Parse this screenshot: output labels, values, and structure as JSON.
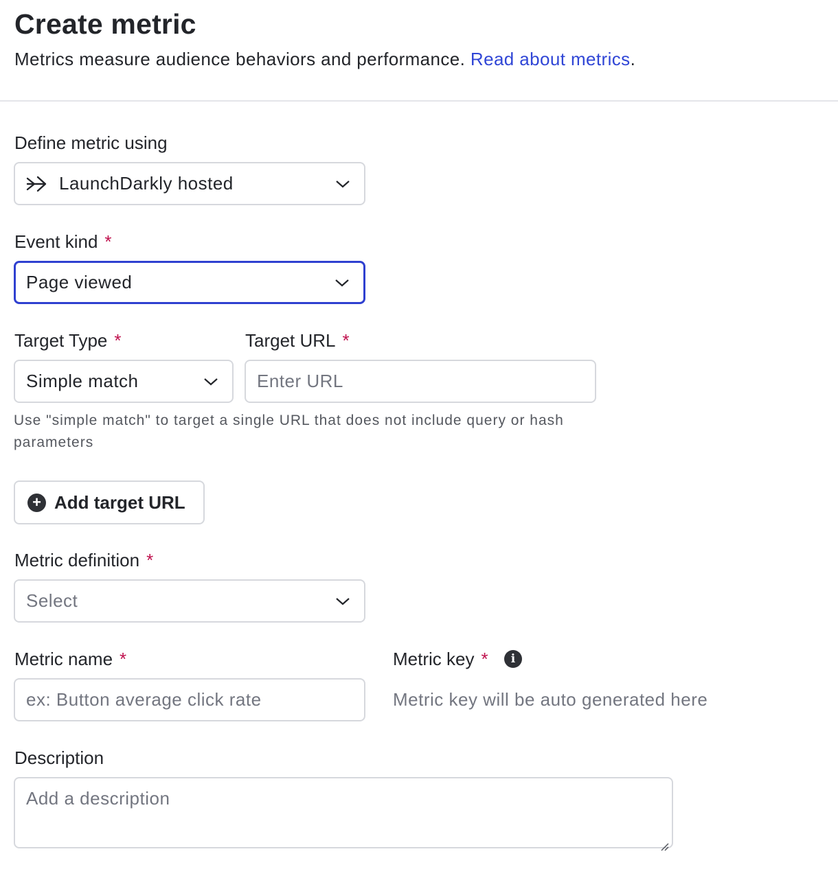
{
  "header": {
    "title": "Create metric",
    "subtitle": "Metrics measure audience behaviors and performance. ",
    "link_text": "Read about metrics",
    "subtitle_end": "."
  },
  "define_metric": {
    "label": "Define metric using",
    "value": "LaunchDarkly hosted",
    "icon": "arrow-right-icon"
  },
  "event_kind": {
    "label": "Event kind",
    "required": "*",
    "value": "Page viewed"
  },
  "target_type": {
    "label": "Target Type",
    "required": "*",
    "value": "Simple match"
  },
  "target_url": {
    "label": "Target URL",
    "required": "*",
    "placeholder": "Enter URL"
  },
  "hint": "Use \"simple match\" to target a single URL that does not include query or hash parameters",
  "add_target_button": {
    "label": "Add target URL",
    "icon": "plus-circle-icon"
  },
  "metric_definition": {
    "label": "Metric definition",
    "required": "*",
    "placeholder": "Select"
  },
  "metric_name": {
    "label": "Metric name",
    "required": "*",
    "placeholder": "ex: Button average click rate"
  },
  "metric_key": {
    "label": "Metric key",
    "required": "*",
    "info_icon": "info-icon",
    "info_glyph": "i",
    "auto_text": "Metric key will be auto generated here"
  },
  "description": {
    "label": "Description",
    "placeholder": "Add a description"
  },
  "colors": {
    "link": "#3046d6",
    "focus_border": "#2f40d0",
    "required": "#c0124e"
  }
}
